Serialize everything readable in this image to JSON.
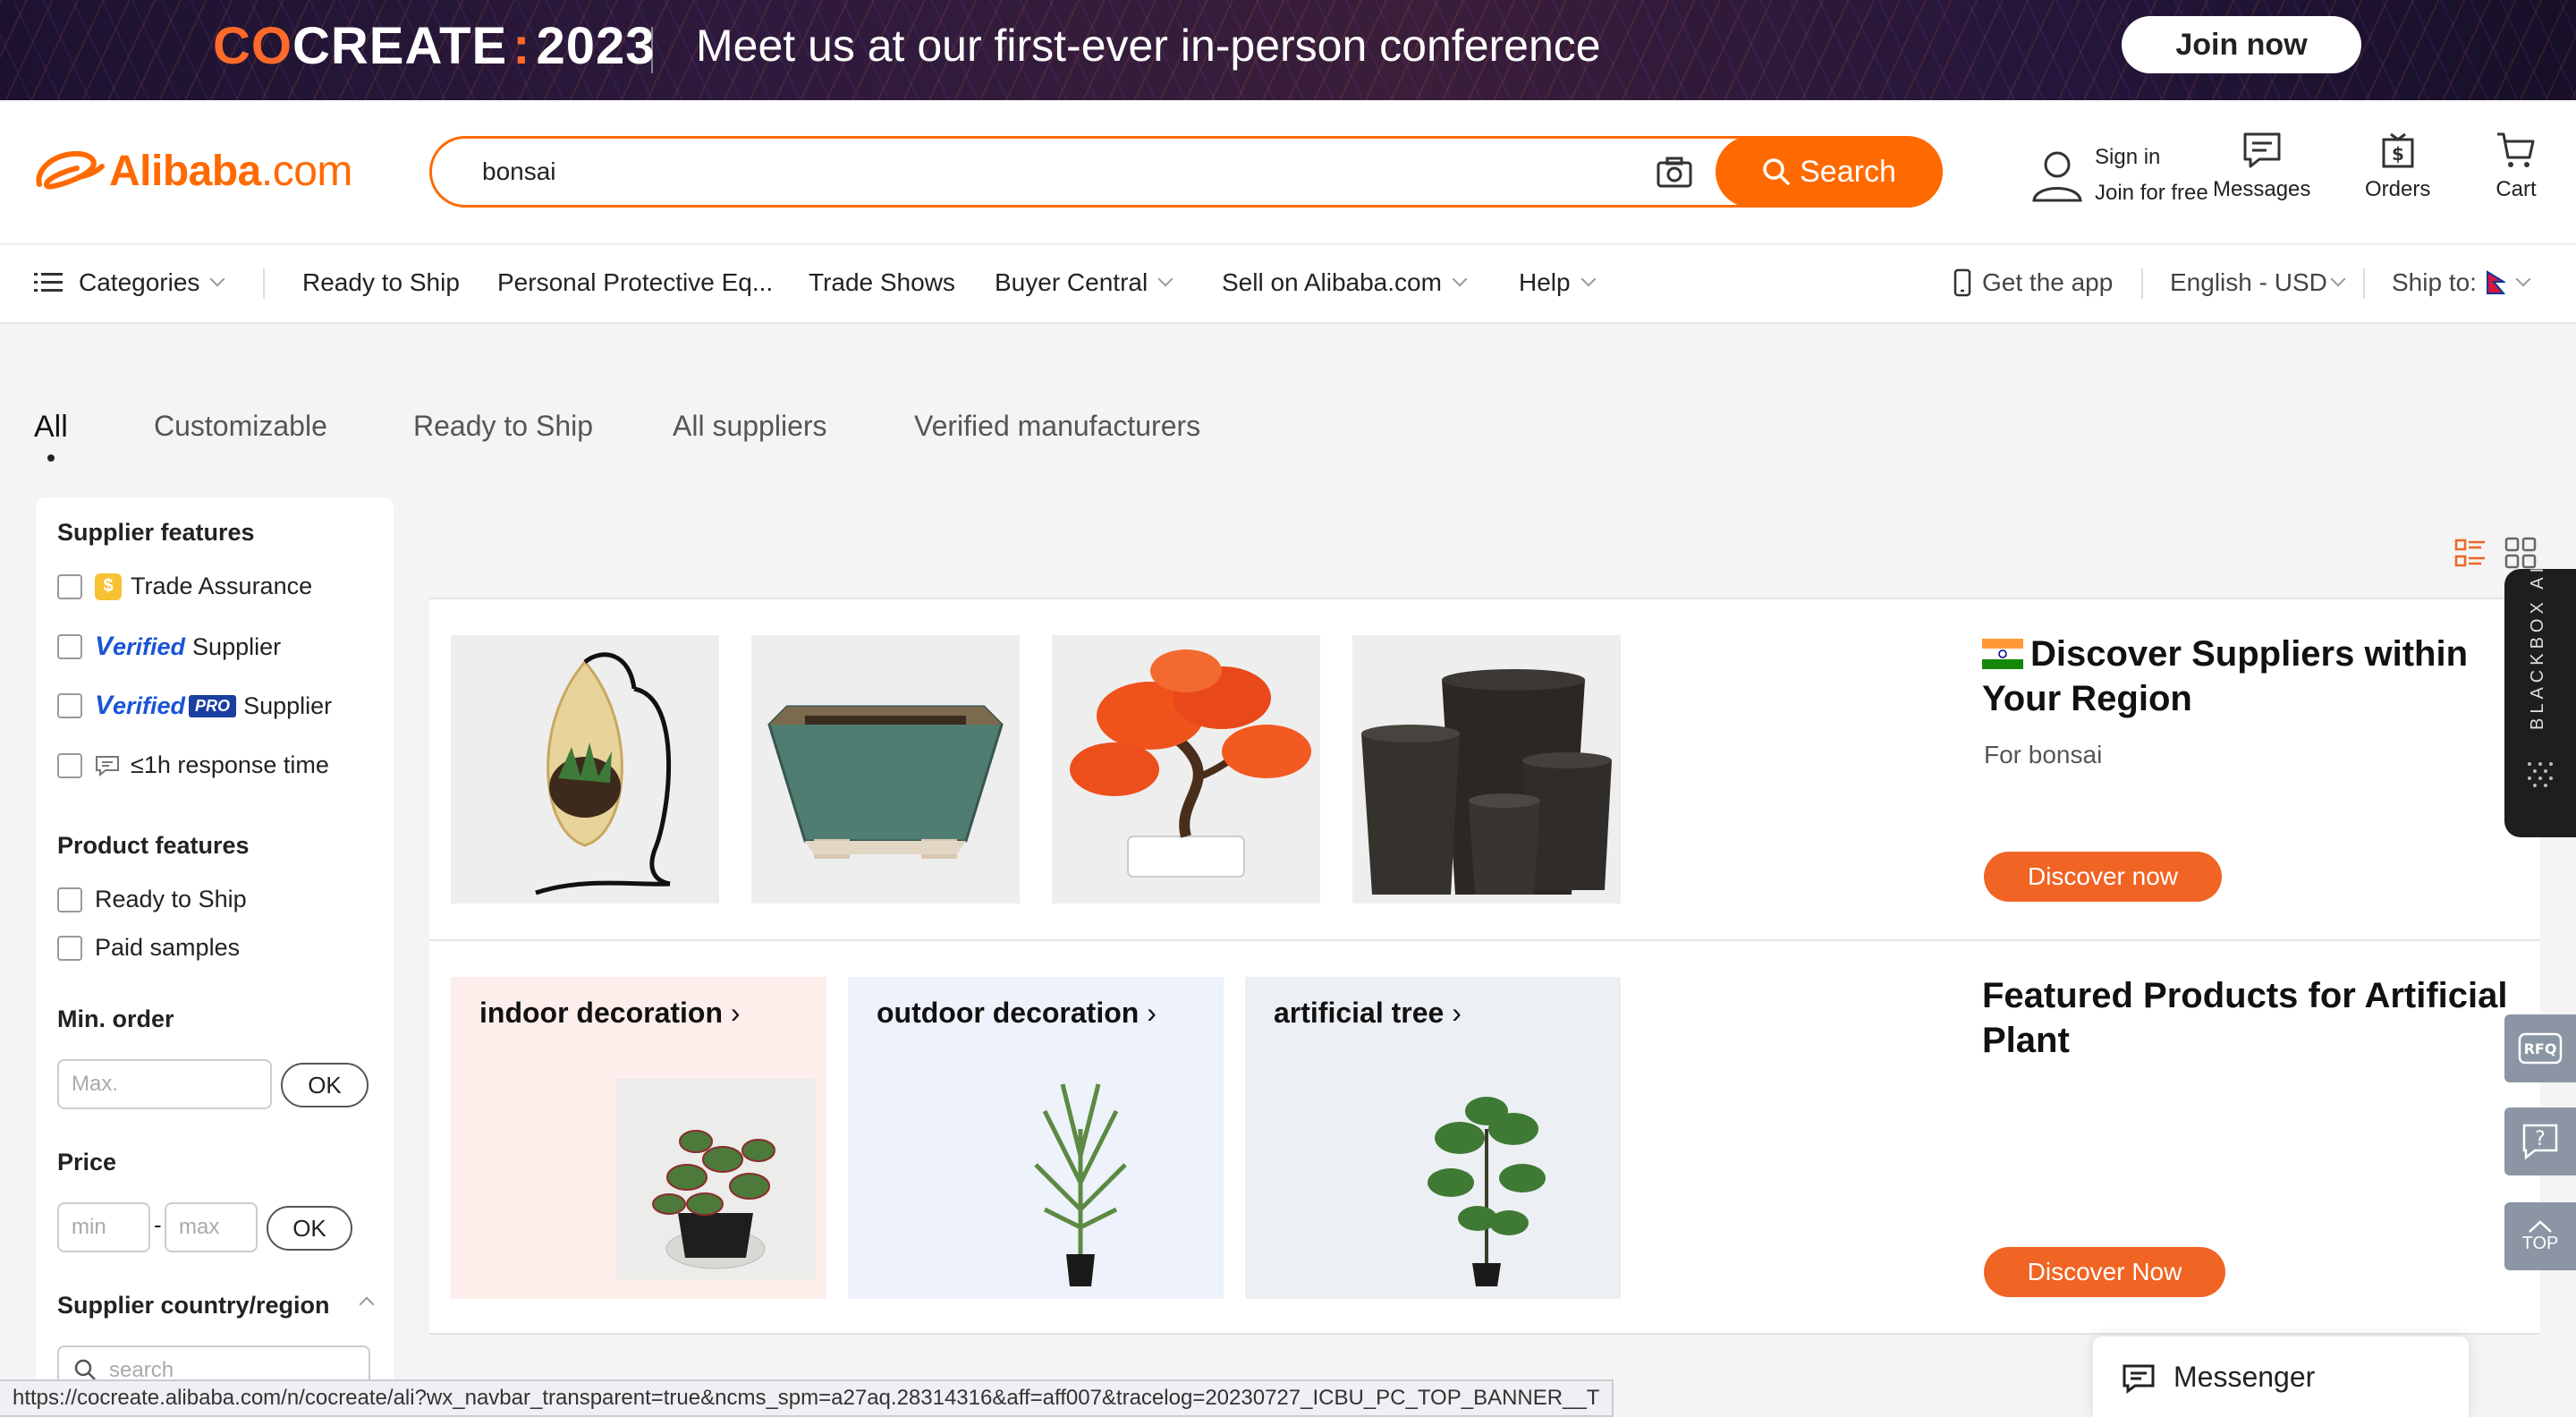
{
  "banner": {
    "brand_co": "CO",
    "brand_rest": "CREATE",
    "brand_colon": ":",
    "brand_year": "2023",
    "text": "Meet us at our first-ever in-person conference",
    "join_label": "Join now"
  },
  "header": {
    "logo_text": "Alibaba",
    "logo_suffix": ".com",
    "search_value": "bonsai",
    "search_label": "Search",
    "sign_in": "Sign in",
    "join_free": "Join for free",
    "messages": "Messages",
    "orders": "Orders",
    "cart": "Cart"
  },
  "nav": {
    "categories": "Categories",
    "items": [
      "Ready to Ship",
      "Personal Protective Eq...",
      "Trade Shows",
      "Buyer Central",
      "Sell on Alibaba.com",
      "Help"
    ],
    "get_app": "Get the app",
    "language": "English - USD",
    "ship_to": "Ship to:"
  },
  "tabs": [
    "All",
    "Customizable",
    "Ready to Ship",
    "All suppliers",
    "Verified manufacturers"
  ],
  "sidebar": {
    "supplier_features": "Supplier features",
    "trade_assurance": "Trade Assurance",
    "verified_word": "erified",
    "verified_v": "V",
    "supplier": "Supplier",
    "pro": "PRO",
    "response": "≤1h response time",
    "product_features": "Product features",
    "ready_to_ship": "Ready to Ship",
    "paid_samples": "Paid samples",
    "min_order": "Min. order",
    "max_placeholder": "Max.",
    "ok": "OK",
    "price": "Price",
    "min_placeholder": "min",
    "max_price_placeholder": "max",
    "dash": "-",
    "country_region": "Supplier country/region",
    "country_search_placeholder": "search"
  },
  "promo1": {
    "title": "Discover Suppliers within Your Region",
    "sub": "For bonsai",
    "button": "Discover now"
  },
  "promo2": {
    "title": "Featured Products for Artificial Plant",
    "button": "Discover Now"
  },
  "category_cards": [
    {
      "label": "indoor decoration"
    },
    {
      "label": "outdoor decoration"
    },
    {
      "label": "artificial tree"
    }
  ],
  "float": {
    "blackbox": "BLACKBOX AI",
    "rfq": "RFQ",
    "top": "TOP"
  },
  "messenger": "Messenger",
  "statusbar": "https://cocreate.alibaba.com/n/cocreate/ali?wx_navbar_transparent=true&ncms_spm=a27aq.28314316&aff=aff007&tracelog=20230727_ICBU_PC_TOP_BANNER__T",
  "colors": {
    "brand_orange": "#ff6a00",
    "button_orange": "#f06424",
    "verified_blue": "#1a54d6"
  }
}
